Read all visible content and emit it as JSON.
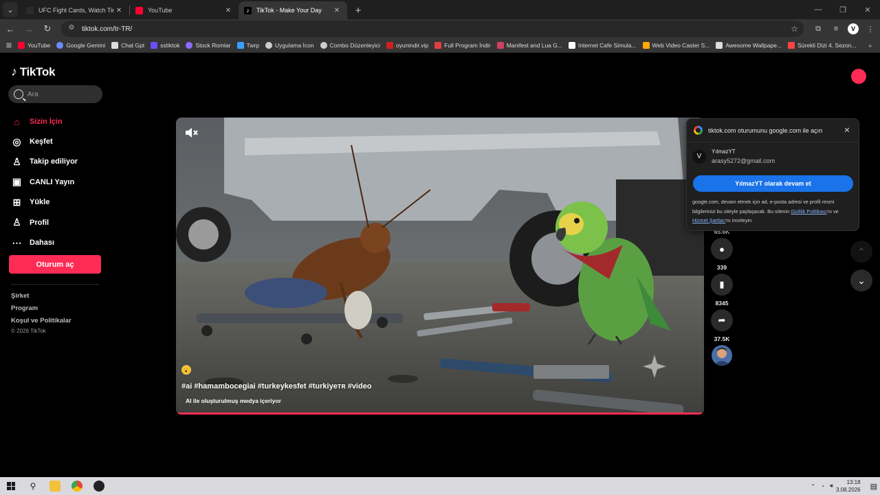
{
  "browser": {
    "tabs": [
      {
        "title": "UFC Fight Cards, Watch Times, ...",
        "active": false,
        "favicon_color": "#2b2b2b"
      },
      {
        "title": "YouTube",
        "active": false,
        "favicon_color": "#ff0033"
      },
      {
        "title": "TikTok - Make Your Day",
        "active": true,
        "favicon_color": "#000000"
      }
    ],
    "url": "tiktok.com/tr-TR/",
    "bookmarks": [
      {
        "label": "YouTube",
        "color": "#ff0033"
      },
      {
        "label": "Google Gemini",
        "color": "#6b8cff"
      },
      {
        "label": "Chat Gpt",
        "color": "#dddddd"
      },
      {
        "label": "sstiktok",
        "color": "#6b4cff"
      },
      {
        "label": "Stock Romlar",
        "color": "#8a6cff"
      },
      {
        "label": "Twrp",
        "color": "#3aa0ff"
      },
      {
        "label": "Uygulama İcon",
        "color": "#cccccc"
      },
      {
        "label": "Combo Düzenleyici",
        "color": "#cccccc"
      },
      {
        "label": "oyunindir.vip",
        "color": "#d02020"
      },
      {
        "label": "Full Program İndir",
        "color": "#e04040"
      },
      {
        "label": "Manifest and Lua G...",
        "color": "#d04060"
      },
      {
        "label": "Internet Cafe Simula...",
        "color": "#ffffff"
      },
      {
        "label": "Web Video Caster S...",
        "color": "#ffaa00"
      },
      {
        "label": "Awesome Wallpape...",
        "color": "#dddddd"
      },
      {
        "label": "Sürekli Dizi 4. Sezon...",
        "color": "#ff4444"
      }
    ],
    "bookmarks_more": "»"
  },
  "tiktok": {
    "logo_text": "TikTok",
    "search_placeholder": "Ara",
    "nav": [
      {
        "label": "Sizin İçin",
        "icon": "home-icon",
        "glyph": "⌂",
        "active": true
      },
      {
        "label": "Keşfet",
        "icon": "compass-icon",
        "glyph": "◎",
        "active": false
      },
      {
        "label": "Takip ediliyor",
        "icon": "following-icon",
        "glyph": "👤",
        "active": false
      },
      {
        "label": "CANLI Yayın",
        "icon": "live-icon",
        "glyph": "▣",
        "active": false
      },
      {
        "label": "Yükle",
        "icon": "upload-icon",
        "glyph": "⊞",
        "active": false
      },
      {
        "label": "Profil",
        "icon": "profile-icon",
        "glyph": "♙",
        "active": false
      },
      {
        "label": "Dahası",
        "icon": "more-icon",
        "glyph": "⋯",
        "active": false
      }
    ],
    "login_label": "Oturum aç",
    "footer": [
      "Şirket",
      "Program",
      "Koşul ve Politikalar"
    ],
    "copyright": "© 2026 TikTok",
    "video": {
      "caption": "#ai #hamambocegiai #turkeykesfet #turkiyeᴛʀ #video",
      "ai_label": "AI ile oluşturulmuş medya içeriyor",
      "emoji": "😮",
      "progress": 1.0
    },
    "actions": {
      "likes": "65.6K",
      "comments": "339",
      "saves": "8345",
      "shares": "37.5K"
    }
  },
  "google_popup": {
    "title": "tiktok.com oturumunu google.com ile açın",
    "account_name": "YılmazYT",
    "account_email": "arasy5272@gmail.com",
    "continue_label": "YılmazYT olarak devam et",
    "disclaimer_pre": "google.com, devam etmek için ad, e-posta adresi ve profil resmi bilgilerinizi bu siteyle paylaşacak. Bu sitenin ",
    "privacy_link": "Gizlilik Politikası",
    "disclaimer_mid": "'nı ve ",
    "terms_link": "Hizmet Şartları",
    "disclaimer_post": "'nı inceleyin."
  },
  "taskbar": {
    "time": "13:18",
    "date": "3.08.2026"
  }
}
